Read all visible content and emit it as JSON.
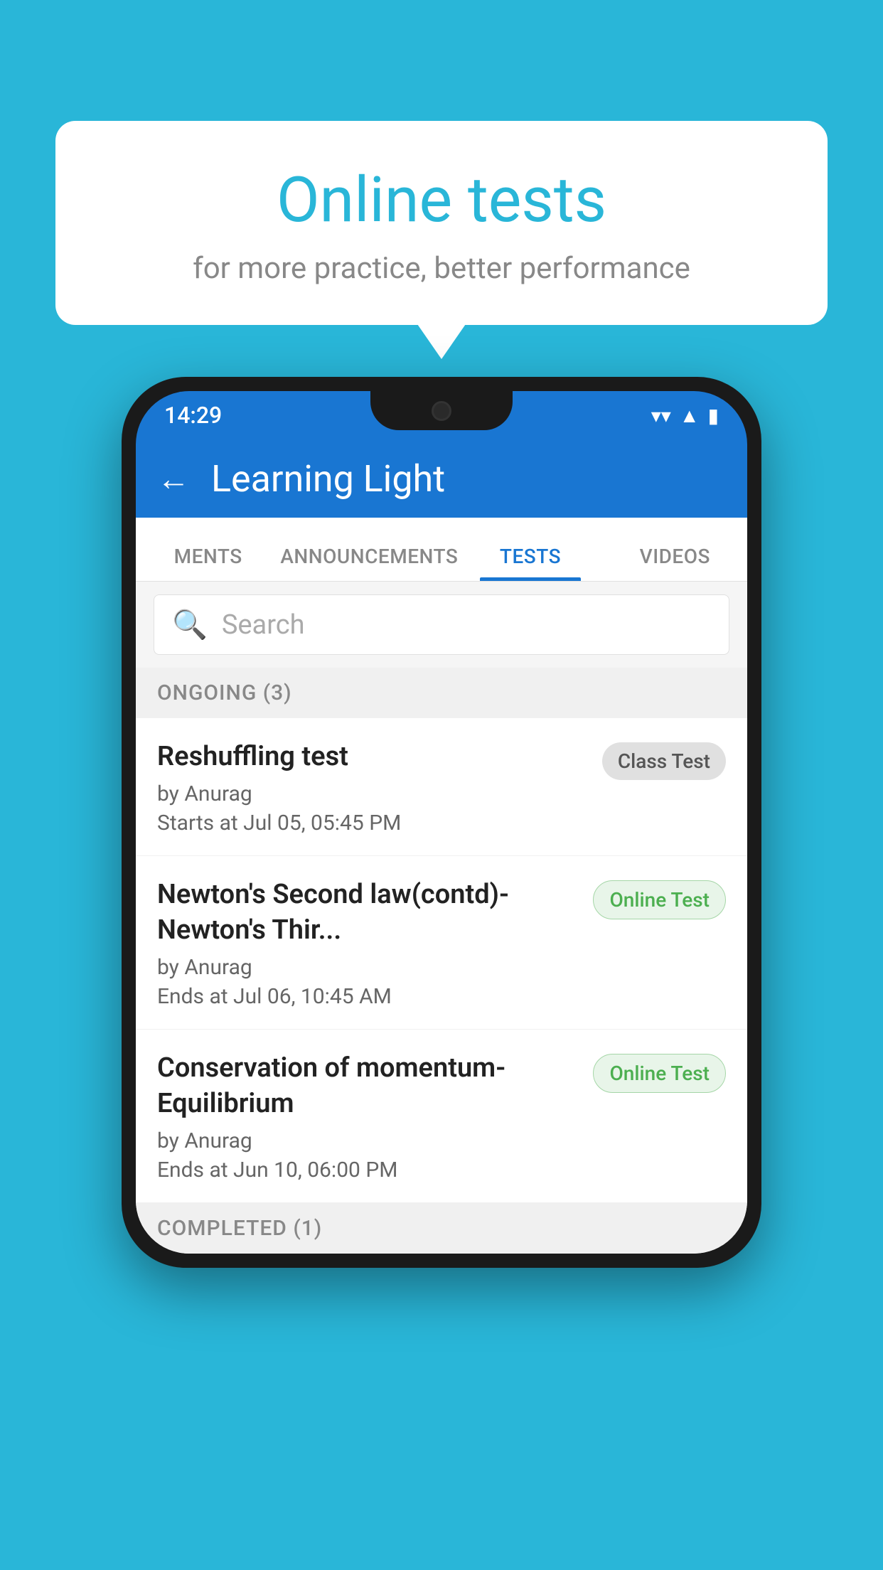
{
  "background_color": "#29b6d8",
  "speech_bubble": {
    "title": "Online tests",
    "subtitle": "for more practice, better performance"
  },
  "phone": {
    "status_bar": {
      "time": "14:29",
      "wifi_icon": "▼",
      "signal_icon": "▲",
      "battery_icon": "▮"
    },
    "header": {
      "back_label": "←",
      "app_title": "Learning Light"
    },
    "tabs": [
      {
        "label": "MENTS",
        "active": false
      },
      {
        "label": "ANNOUNCEMENTS",
        "active": false
      },
      {
        "label": "TESTS",
        "active": true
      },
      {
        "label": "VIDEOS",
        "active": false
      }
    ],
    "search": {
      "placeholder": "Search"
    },
    "ongoing_section": {
      "label": "ONGOING (3)"
    },
    "tests": [
      {
        "name": "Reshuffling test",
        "author": "by Anurag",
        "date": "Starts at  Jul 05, 05:45 PM",
        "badge": "Class Test",
        "badge_type": "class"
      },
      {
        "name": "Newton's Second law(contd)-Newton's Thir...",
        "author": "by Anurag",
        "date": "Ends at  Jul 06, 10:45 AM",
        "badge": "Online Test",
        "badge_type": "online"
      },
      {
        "name": "Conservation of momentum-Equilibrium",
        "author": "by Anurag",
        "date": "Ends at  Jun 10, 06:00 PM",
        "badge": "Online Test",
        "badge_type": "online"
      }
    ],
    "completed_section": {
      "label": "COMPLETED (1)"
    }
  }
}
